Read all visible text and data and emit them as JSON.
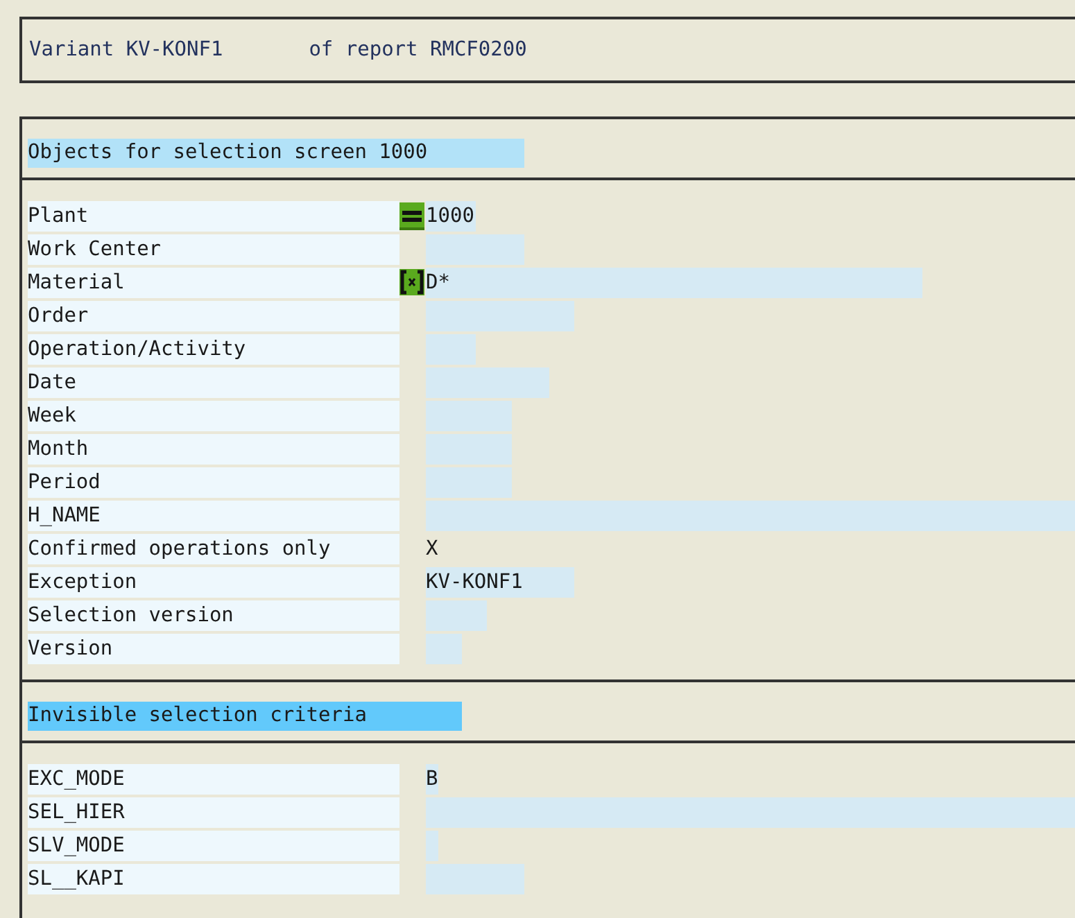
{
  "header": {
    "variant_label": "Variant KV-KONF1",
    "report_label": "of report RMCF0200"
  },
  "sections": [
    {
      "title": "Objects for selection screen 1000",
      "color": "#b2e2f8",
      "rows": [
        {
          "label": "Plant",
          "kind": "input",
          "operator": {
            "kind": "equals"
          },
          "value": "1000"
        },
        {
          "label": "Work Center",
          "kind": "input"
        },
        {
          "label": "Material",
          "kind": "input",
          "operator": {
            "kind": "pattern"
          },
          "value": "D*"
        },
        {
          "label": "Order",
          "kind": "input"
        },
        {
          "label": "Operation/Activity",
          "kind": "input"
        },
        {
          "label": "Date",
          "kind": "input"
        },
        {
          "label": "Week",
          "kind": "input"
        },
        {
          "label": "Month",
          "kind": "input"
        },
        {
          "label": "Period",
          "kind": "input"
        },
        {
          "label": "H_NAME",
          "kind": "input"
        },
        {
          "label": "Confirmed operations only",
          "kind": "flag",
          "value": "X"
        },
        {
          "label": "Exception",
          "kind": "input",
          "value": "KV-KONF1"
        },
        {
          "label": "Selection version",
          "kind": "input"
        },
        {
          "label": "Version",
          "kind": "input"
        }
      ]
    },
    {
      "title": "Invisible selection criteria",
      "color": "#62c9fb",
      "rows": [
        {
          "label": "EXC_MODE",
          "kind": "input",
          "value": "B"
        },
        {
          "label": "SEL_HIER",
          "kind": "input"
        },
        {
          "label": "SLV_MODE",
          "kind": "input"
        },
        {
          "label": "SL__KAPI",
          "kind": "input"
        }
      ]
    }
  ]
}
